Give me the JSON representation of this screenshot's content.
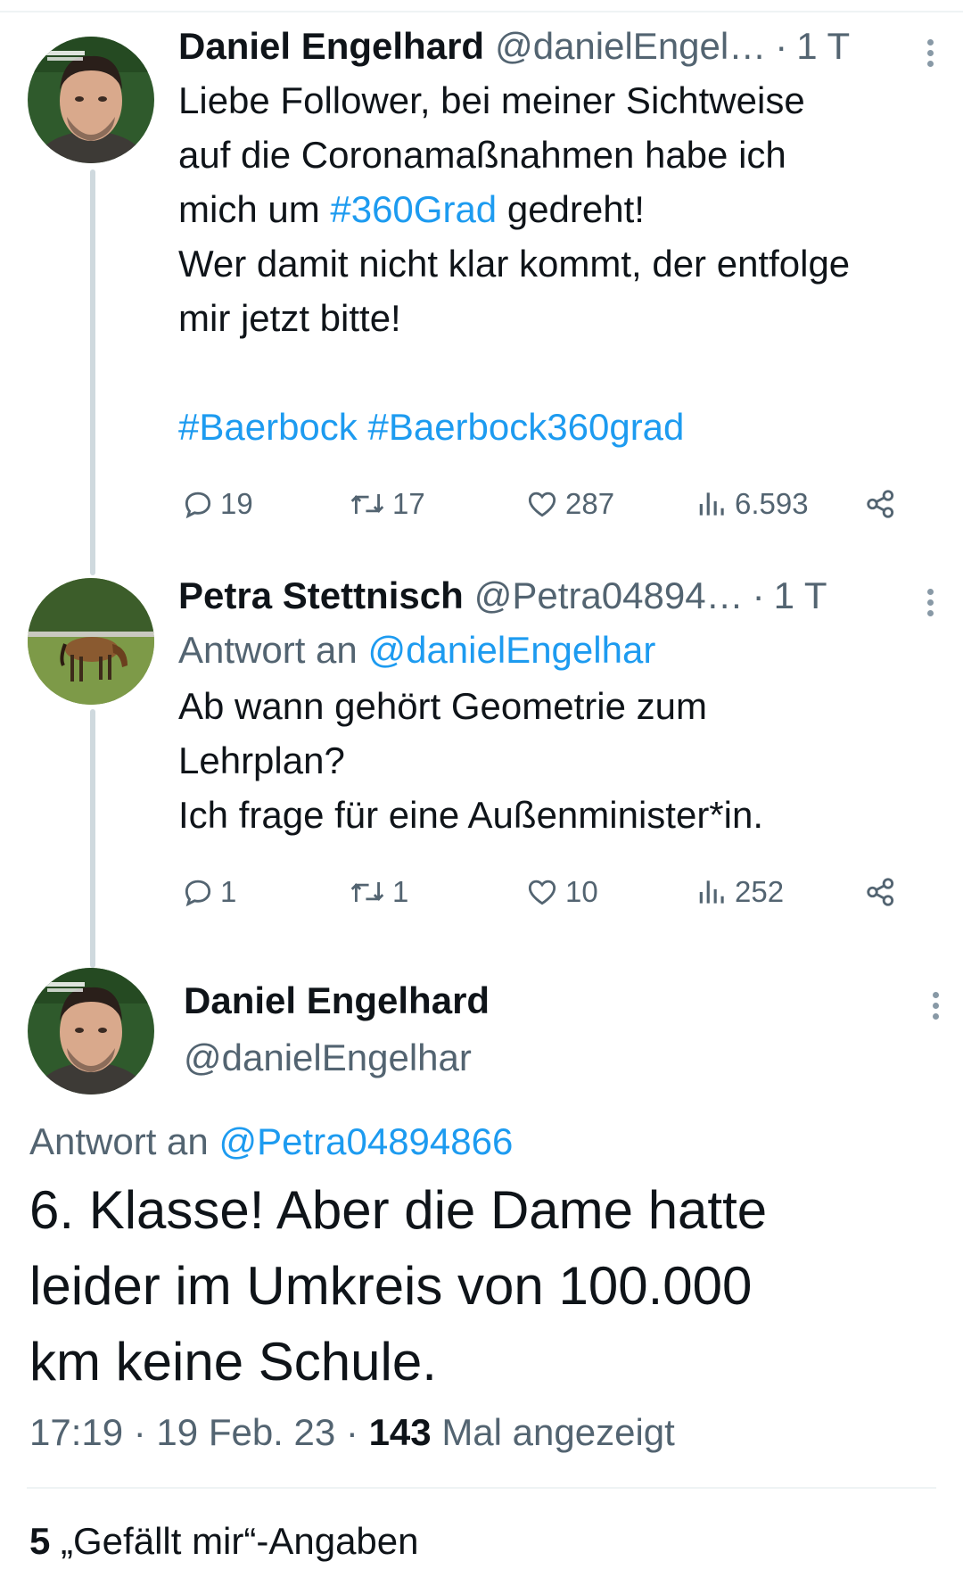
{
  "tweets": [
    {
      "name": "Daniel Engelhard",
      "handle": "@danielEngel…",
      "time": "1 T",
      "text_lines": [
        "Liebe Follower, bei meiner Sichtweise",
        "auf die Coronamaßnahmen habe ich"
      ],
      "text_line3_pre": "mich um ",
      "text_line3_tag": "#360Grad",
      "text_line3_post": " gedreht!",
      "text_line4": "Wer damit nicht klar kommt, der entfolge",
      "text_line5": "mir jetzt bitte!",
      "hashtags": [
        "#Baerbock",
        "#Baerbock360grad"
      ],
      "replies": "19",
      "retweets": "17",
      "likes": "287",
      "views": "6.593"
    },
    {
      "name": "Petra Stettnisch",
      "handle": "@Petra04894…",
      "time": "1 T",
      "reply_prefix": "Antwort an ",
      "reply_to": "@danielEngelhar",
      "text_lines": [
        "Ab wann gehört Geometrie zum",
        "Lehrplan?",
        "Ich frage für eine Außenminister*in."
      ],
      "replies": "1",
      "retweets": "1",
      "likes": "10",
      "views": "252"
    }
  ],
  "main_tweet": {
    "name": "Daniel Engelhard",
    "handle": "@danielEngelhar",
    "reply_prefix": "Antwort an ",
    "reply_to": "@Petra04894866",
    "text_lines": [
      "6. Klasse! Aber die Dame hatte",
      "leider im Umkreis von 100.000",
      "km keine Schule."
    ],
    "timestamp": "17:19 · 19 Feb. 23 · ",
    "view_count": "143",
    "view_label": " Mal angezeigt",
    "likes_count": "5",
    "likes_label": " „Gefällt mir“-Angaben"
  },
  "colors": {
    "accent": "#1d9bf0",
    "muted": "#536471",
    "thread_line": "#cfd9de"
  }
}
